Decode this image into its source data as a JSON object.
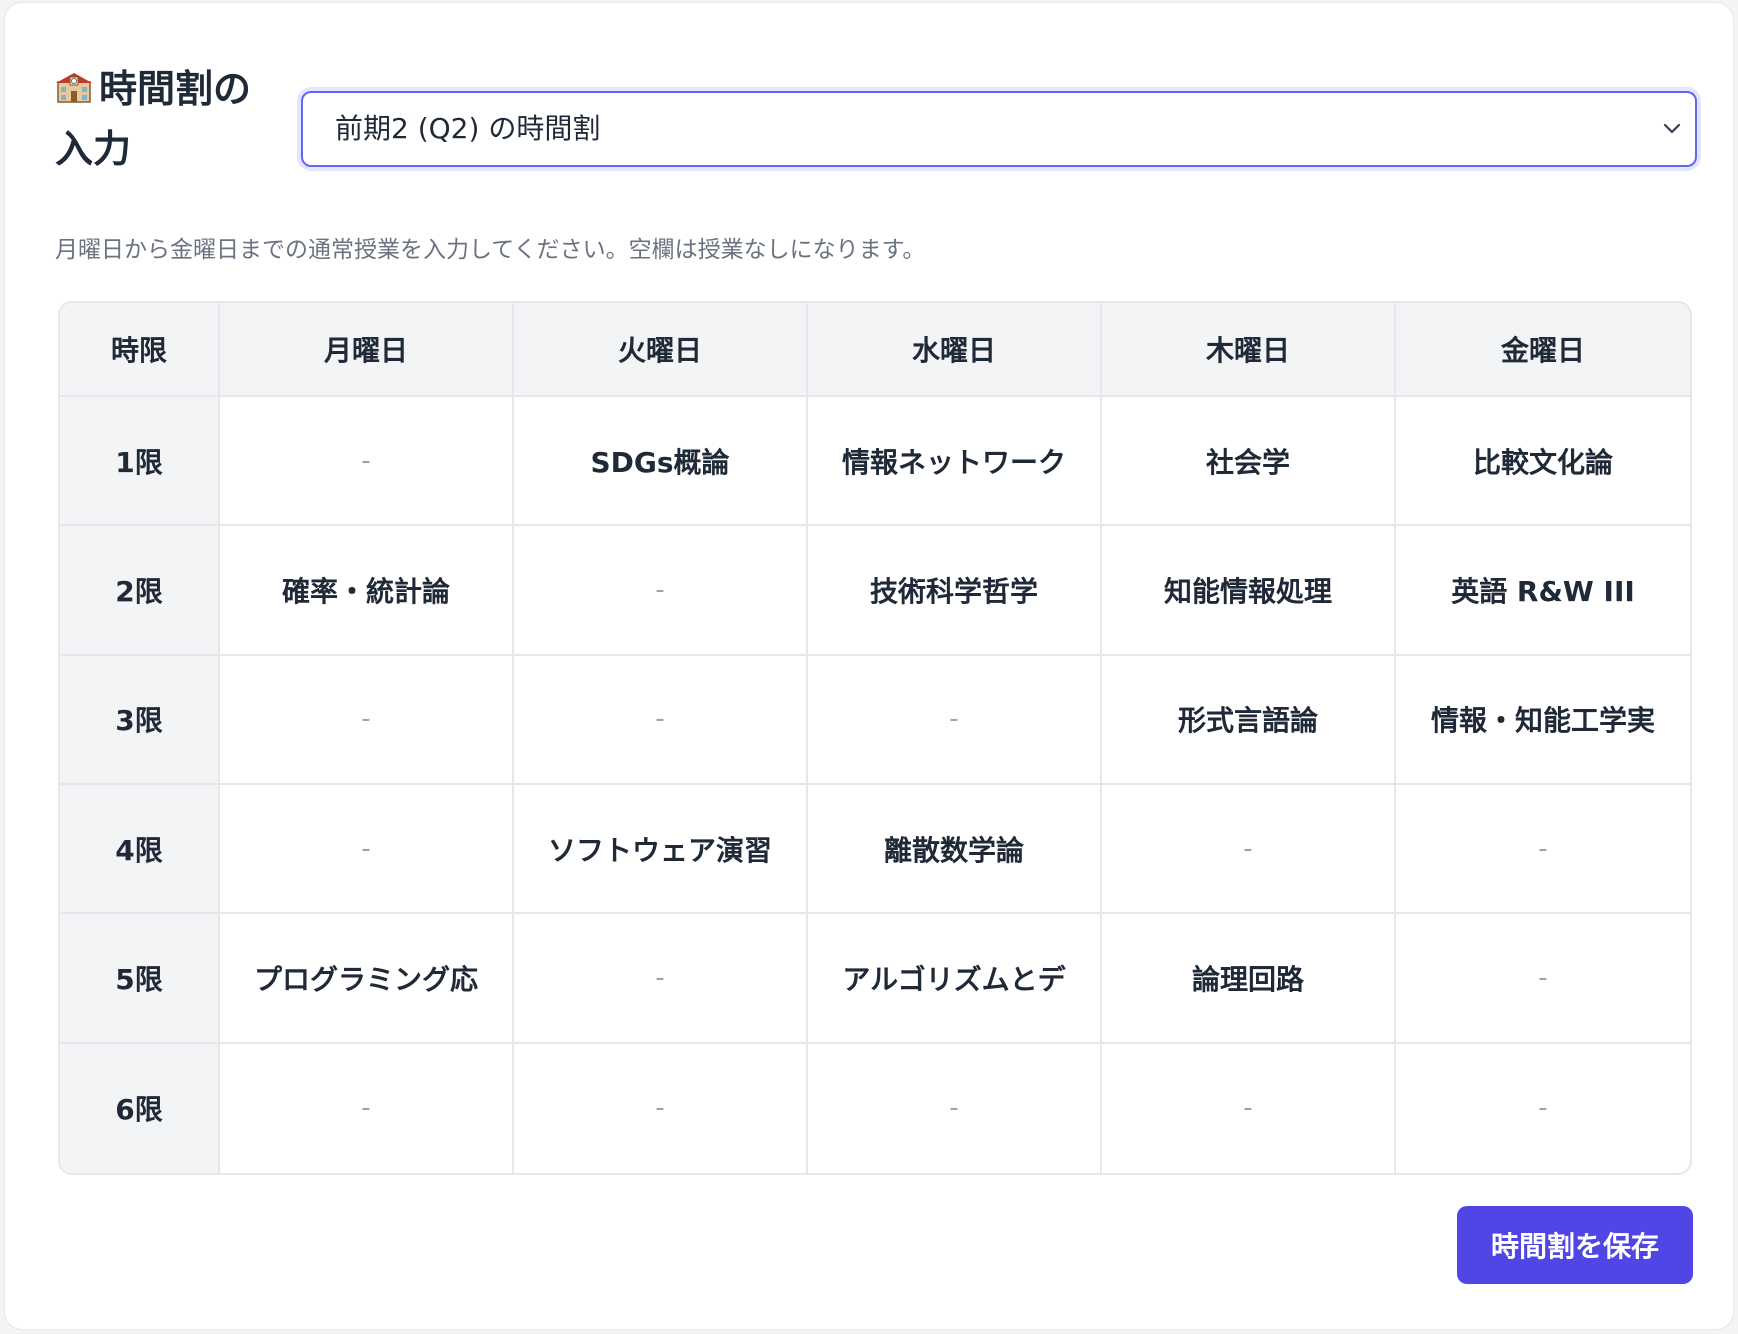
{
  "header": {
    "title": "時間割の入力",
    "icon": "school-building-icon"
  },
  "quarter_select": {
    "value": "前期2 (Q2) の時間割",
    "icon": "chevron-down-icon"
  },
  "description": "月曜日から金曜日までの通常授業を入力してください。空欄は授業なしになります。",
  "timetable": {
    "columns": [
      "時限",
      "月曜日",
      "火曜日",
      "水曜日",
      "木曜日",
      "金曜日"
    ],
    "rows": [
      {
        "period": "1限",
        "cells": [
          "-",
          "SDGs概論",
          "情報ネットワーク",
          "社会学",
          "比較文化論"
        ]
      },
      {
        "period": "2限",
        "cells": [
          "確率・統計論",
          "-",
          "技術科学哲学",
          "知能情報処理",
          "英語 R&W III"
        ]
      },
      {
        "period": "3限",
        "cells": [
          "-",
          "-",
          "-",
          "形式言語論",
          "情報・知能工学実"
        ]
      },
      {
        "period": "4限",
        "cells": [
          "-",
          "ソフトウェア演習",
          "離散数学論",
          "-",
          "-"
        ]
      },
      {
        "period": "5限",
        "cells": [
          "プログラミング応",
          "-",
          "アルゴリズムとデ",
          "論理回路",
          "-"
        ]
      },
      {
        "period": "6限",
        "cells": [
          "-",
          "-",
          "-",
          "-",
          "-"
        ]
      }
    ]
  },
  "save_button": "時間割を保存",
  "colors": {
    "accent": "#4f46e5",
    "focus_ring": "#6366f1",
    "header_bg": "#f3f4f6",
    "border": "#e5e7eb",
    "muted_text": "#6b7280"
  }
}
